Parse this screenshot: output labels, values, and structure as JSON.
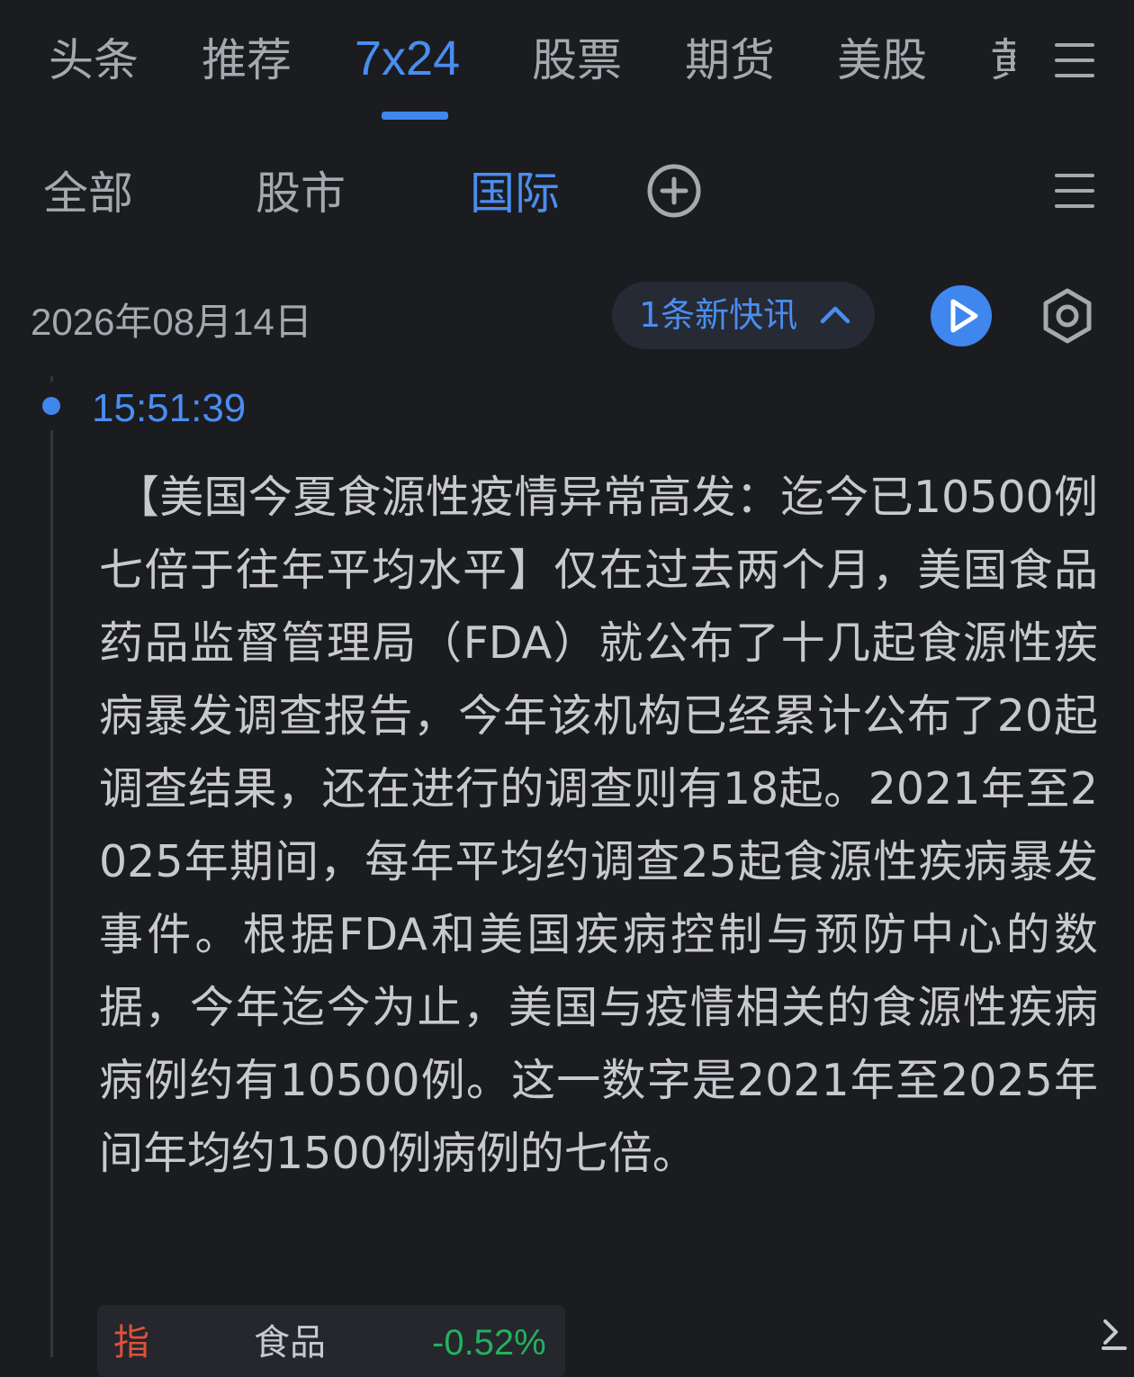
{
  "top_tabs": [
    {
      "label": "头条"
    },
    {
      "label": "推荐"
    },
    {
      "label": "7x24"
    },
    {
      "label": "股票"
    },
    {
      "label": "期货"
    },
    {
      "label": "美股"
    },
    {
      "label": "黄"
    }
  ],
  "top_tabs_active": "7x24",
  "sub_tabs": [
    {
      "label": "全部"
    },
    {
      "label": "股市"
    },
    {
      "label": "国际"
    }
  ],
  "sub_tabs_active": "国际",
  "icons": {
    "top_menu": "menu-icon",
    "sub_menu": "menu-icon",
    "add": "plus-circle-icon",
    "new_pill": "chevron-up-icon",
    "play": "play-icon",
    "settings": "hexagon-settings-icon",
    "share": "share-icon"
  },
  "feed": {
    "date": "2026年08月14日",
    "new_count_label": "1条新快讯",
    "item": {
      "time": "15:51:39",
      "content": "【美国今夏食源性疫情异常高发：迄今已10500例 七倍于往年平均水平】仅在过去两个月，美国食品药品监督管理局（FDA）就公布了十几起食源性疾病暴发调查报告，今年该机构已经累计公布了20起调查结果，还在进行的调查则有18起。2021年至2025年期间，每年平均约调查25起食源性疾病暴发事件。根据FDA和美国疾病控制与预防中心的数据，今年迄今为止，美国与疫情相关的食源性疾病病例约有10500例。这一数字是2021年至2025年间年均约1500例病例的七倍。",
      "stock": {
        "tag": "指",
        "name": "食品",
        "change": "-0.52%"
      }
    }
  },
  "colors": {
    "background": "#1b1c20",
    "accent": "#3f86ee",
    "text": "#c8c9ce",
    "muted": "#a6a8ae",
    "down": "#23b15d",
    "tag": "#e0523a"
  }
}
